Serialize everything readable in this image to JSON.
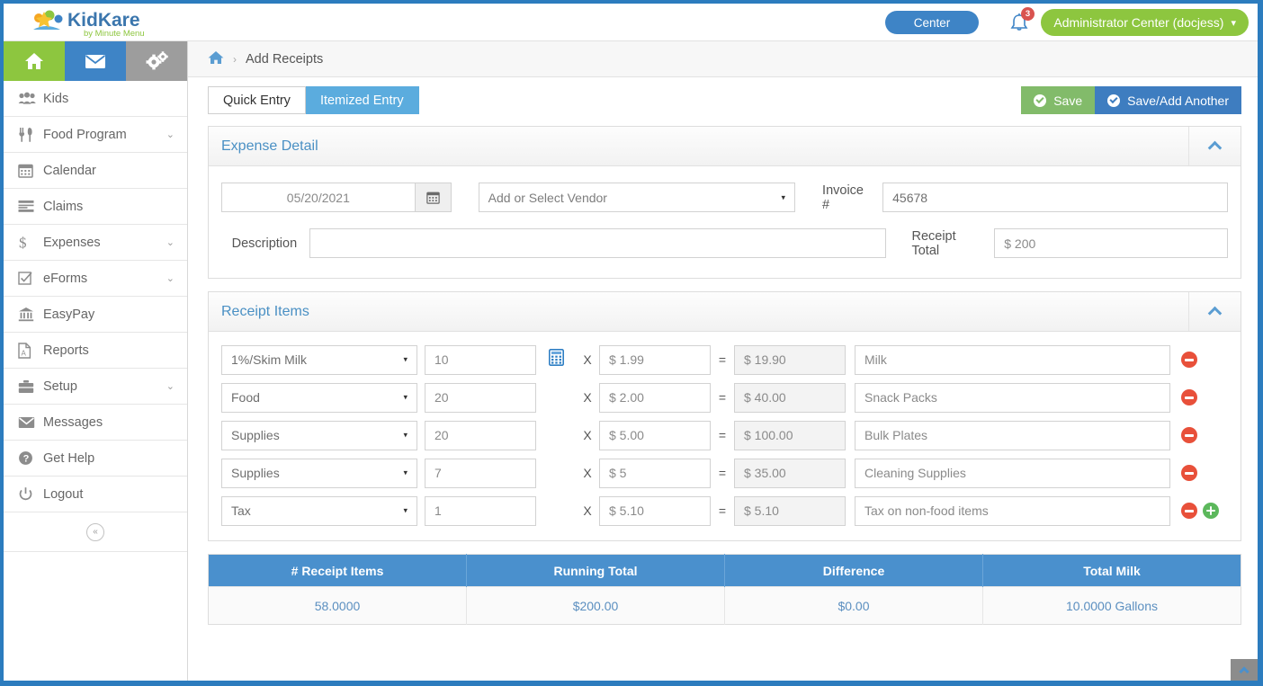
{
  "header": {
    "logo_main": "KidKare",
    "logo_sub": "by Minute Menu",
    "center_label": "Center",
    "notification_count": "3",
    "user_label": "Administrator Center (docjess)",
    "caret": "▾"
  },
  "quick_icons": [
    {
      "name": "home-icon",
      "label": "Home"
    },
    {
      "name": "mail-icon",
      "label": "Messages"
    },
    {
      "name": "gears-icon",
      "label": "Settings"
    }
  ],
  "sidebar": {
    "items": [
      {
        "label": "Kids",
        "icon": "kids-icon",
        "chevron": ""
      },
      {
        "label": "Food Program",
        "icon": "food-icon",
        "chevron": "⌄"
      },
      {
        "label": "Calendar",
        "icon": "calendar-icon",
        "chevron": ""
      },
      {
        "label": "Claims",
        "icon": "claims-icon",
        "chevron": ""
      },
      {
        "label": "Expenses",
        "icon": "dollar-icon",
        "chevron": "⌄"
      },
      {
        "label": "eForms",
        "icon": "checkbox-icon",
        "chevron": "⌄"
      },
      {
        "label": "EasyPay",
        "icon": "bank-icon",
        "chevron": ""
      },
      {
        "label": "Reports",
        "icon": "report-icon",
        "chevron": ""
      },
      {
        "label": "Setup",
        "icon": "briefcase-icon",
        "chevron": "⌄"
      },
      {
        "label": "Messages",
        "icon": "envelope-icon",
        "chevron": ""
      },
      {
        "label": "Get Help",
        "icon": "question-icon",
        "chevron": ""
      },
      {
        "label": "Logout",
        "icon": "power-icon",
        "chevron": ""
      }
    ],
    "collapse_glyph": "«"
  },
  "breadcrumb": {
    "home_icon": "home-icon",
    "separator": "›",
    "current": "Add Receipts"
  },
  "toolbar": {
    "tabs": [
      {
        "label": "Quick Entry",
        "active": false
      },
      {
        "label": "Itemized Entry",
        "active": true
      }
    ],
    "save_label": "Save",
    "save_add_label": "Save/Add Another"
  },
  "expense_detail": {
    "title": "Expense Detail",
    "date_value": "05/20/2021",
    "date_icon": "calendar-icon",
    "vendor_value": "Add or Select Vendor",
    "invoice_label": "Invoice #",
    "invoice_value": "45678",
    "description_label": "Description",
    "description_value": "",
    "description_placeholder": "",
    "receipt_total_label": "Receipt Total",
    "receipt_total_value": "$ 200",
    "collapse_icon": "chevron-up-icon"
  },
  "receipt_items": {
    "title": "Receipt Items",
    "collapse_icon": "chevron-up-icon",
    "multiply_symbol": "X",
    "equals_symbol": "=",
    "rows": [
      {
        "category": "1%/Skim Milk",
        "quantity": "10",
        "has_calculator": true,
        "price": "$ 1.99",
        "total": "$ 19.90",
        "description": "Milk",
        "has_add": false
      },
      {
        "category": "Food",
        "quantity": "20",
        "has_calculator": false,
        "price": "$ 2.00",
        "total": "$ 40.00",
        "description": "Snack Packs",
        "has_add": false
      },
      {
        "category": "Supplies",
        "quantity": "20",
        "has_calculator": false,
        "price": "$ 5.00",
        "total": "$ 100.00",
        "description": "Bulk Plates",
        "has_add": false
      },
      {
        "category": "Supplies",
        "quantity": "7",
        "has_calculator": false,
        "price": "$ 5",
        "total": "$ 35.00",
        "description": "Cleaning Supplies",
        "has_add": false
      },
      {
        "category": "Tax",
        "quantity": "1",
        "has_calculator": false,
        "price": "$ 5.10",
        "total": "$ 5.10",
        "description": "Tax on non-food items",
        "has_add": true
      }
    ]
  },
  "summary": {
    "headers": [
      "# Receipt Items",
      "Running Total",
      "Difference",
      "Total Milk"
    ],
    "values": [
      "58.0000",
      "$200.00",
      "$0.00",
      "10.0000 Gallons"
    ]
  },
  "footer": {
    "scroll_top_icon": "chevron-up-icon"
  },
  "colors": {
    "brand_blue": "#2c7cbe",
    "accent_blue": "#4a90cd",
    "green": "#8dc63f",
    "tab_active": "#5bacde",
    "danger_red": "#e8503a",
    "plus_green": "#5cb85c"
  }
}
